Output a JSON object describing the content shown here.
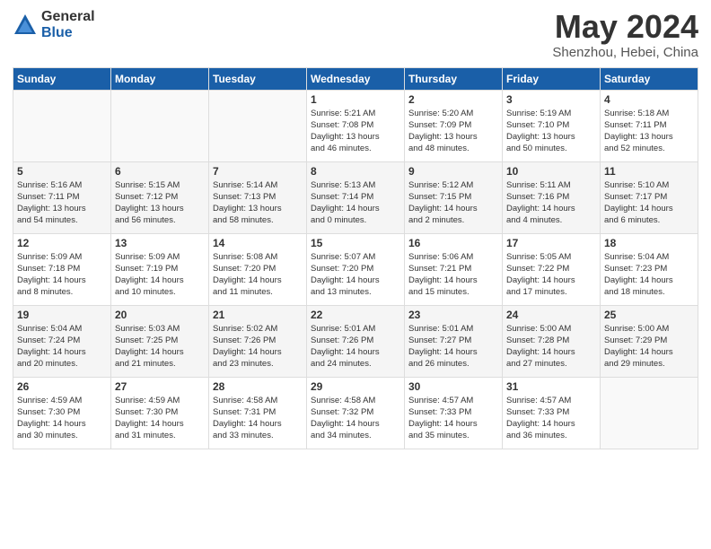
{
  "header": {
    "logo_general": "General",
    "logo_blue": "Blue",
    "title": "May 2024",
    "subtitle": "Shenzhou, Hebei, China"
  },
  "weekdays": [
    "Sunday",
    "Monday",
    "Tuesday",
    "Wednesday",
    "Thursday",
    "Friday",
    "Saturday"
  ],
  "weeks": [
    [
      {
        "day": "",
        "info": ""
      },
      {
        "day": "",
        "info": ""
      },
      {
        "day": "",
        "info": ""
      },
      {
        "day": "1",
        "info": "Sunrise: 5:21 AM\nSunset: 7:08 PM\nDaylight: 13 hours\nand 46 minutes."
      },
      {
        "day": "2",
        "info": "Sunrise: 5:20 AM\nSunset: 7:09 PM\nDaylight: 13 hours\nand 48 minutes."
      },
      {
        "day": "3",
        "info": "Sunrise: 5:19 AM\nSunset: 7:10 PM\nDaylight: 13 hours\nand 50 minutes."
      },
      {
        "day": "4",
        "info": "Sunrise: 5:18 AM\nSunset: 7:11 PM\nDaylight: 13 hours\nand 52 minutes."
      }
    ],
    [
      {
        "day": "5",
        "info": "Sunrise: 5:16 AM\nSunset: 7:11 PM\nDaylight: 13 hours\nand 54 minutes."
      },
      {
        "day": "6",
        "info": "Sunrise: 5:15 AM\nSunset: 7:12 PM\nDaylight: 13 hours\nand 56 minutes."
      },
      {
        "day": "7",
        "info": "Sunrise: 5:14 AM\nSunset: 7:13 PM\nDaylight: 13 hours\nand 58 minutes."
      },
      {
        "day": "8",
        "info": "Sunrise: 5:13 AM\nSunset: 7:14 PM\nDaylight: 14 hours\nand 0 minutes."
      },
      {
        "day": "9",
        "info": "Sunrise: 5:12 AM\nSunset: 7:15 PM\nDaylight: 14 hours\nand 2 minutes."
      },
      {
        "day": "10",
        "info": "Sunrise: 5:11 AM\nSunset: 7:16 PM\nDaylight: 14 hours\nand 4 minutes."
      },
      {
        "day": "11",
        "info": "Sunrise: 5:10 AM\nSunset: 7:17 PM\nDaylight: 14 hours\nand 6 minutes."
      }
    ],
    [
      {
        "day": "12",
        "info": "Sunrise: 5:09 AM\nSunset: 7:18 PM\nDaylight: 14 hours\nand 8 minutes."
      },
      {
        "day": "13",
        "info": "Sunrise: 5:09 AM\nSunset: 7:19 PM\nDaylight: 14 hours\nand 10 minutes."
      },
      {
        "day": "14",
        "info": "Sunrise: 5:08 AM\nSunset: 7:20 PM\nDaylight: 14 hours\nand 11 minutes."
      },
      {
        "day": "15",
        "info": "Sunrise: 5:07 AM\nSunset: 7:20 PM\nDaylight: 14 hours\nand 13 minutes."
      },
      {
        "day": "16",
        "info": "Sunrise: 5:06 AM\nSunset: 7:21 PM\nDaylight: 14 hours\nand 15 minutes."
      },
      {
        "day": "17",
        "info": "Sunrise: 5:05 AM\nSunset: 7:22 PM\nDaylight: 14 hours\nand 17 minutes."
      },
      {
        "day": "18",
        "info": "Sunrise: 5:04 AM\nSunset: 7:23 PM\nDaylight: 14 hours\nand 18 minutes."
      }
    ],
    [
      {
        "day": "19",
        "info": "Sunrise: 5:04 AM\nSunset: 7:24 PM\nDaylight: 14 hours\nand 20 minutes."
      },
      {
        "day": "20",
        "info": "Sunrise: 5:03 AM\nSunset: 7:25 PM\nDaylight: 14 hours\nand 21 minutes."
      },
      {
        "day": "21",
        "info": "Sunrise: 5:02 AM\nSunset: 7:26 PM\nDaylight: 14 hours\nand 23 minutes."
      },
      {
        "day": "22",
        "info": "Sunrise: 5:01 AM\nSunset: 7:26 PM\nDaylight: 14 hours\nand 24 minutes."
      },
      {
        "day": "23",
        "info": "Sunrise: 5:01 AM\nSunset: 7:27 PM\nDaylight: 14 hours\nand 26 minutes."
      },
      {
        "day": "24",
        "info": "Sunrise: 5:00 AM\nSunset: 7:28 PM\nDaylight: 14 hours\nand 27 minutes."
      },
      {
        "day": "25",
        "info": "Sunrise: 5:00 AM\nSunset: 7:29 PM\nDaylight: 14 hours\nand 29 minutes."
      }
    ],
    [
      {
        "day": "26",
        "info": "Sunrise: 4:59 AM\nSunset: 7:30 PM\nDaylight: 14 hours\nand 30 minutes."
      },
      {
        "day": "27",
        "info": "Sunrise: 4:59 AM\nSunset: 7:30 PM\nDaylight: 14 hours\nand 31 minutes."
      },
      {
        "day": "28",
        "info": "Sunrise: 4:58 AM\nSunset: 7:31 PM\nDaylight: 14 hours\nand 33 minutes."
      },
      {
        "day": "29",
        "info": "Sunrise: 4:58 AM\nSunset: 7:32 PM\nDaylight: 14 hours\nand 34 minutes."
      },
      {
        "day": "30",
        "info": "Sunrise: 4:57 AM\nSunset: 7:33 PM\nDaylight: 14 hours\nand 35 minutes."
      },
      {
        "day": "31",
        "info": "Sunrise: 4:57 AM\nSunset: 7:33 PM\nDaylight: 14 hours\nand 36 minutes."
      },
      {
        "day": "",
        "info": ""
      }
    ]
  ]
}
